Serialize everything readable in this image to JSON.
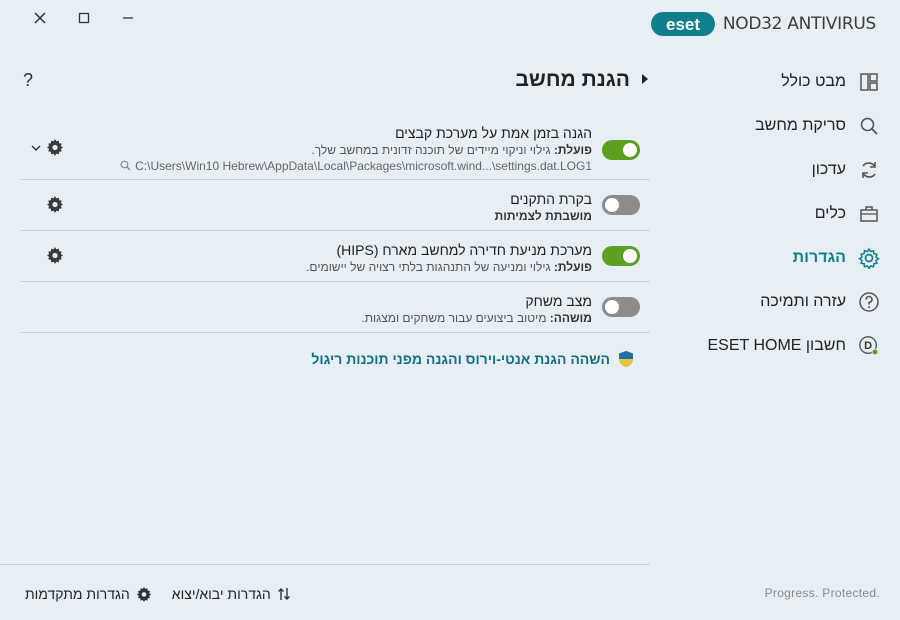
{
  "window": {
    "close": "close",
    "maximize": "maximize",
    "minimize": "minimize"
  },
  "brand": {
    "logo_text": "eset",
    "product": "NOD32 ANTIVIRUS"
  },
  "sidebar": {
    "items": [
      {
        "label": "מבט כולל",
        "icon": "overview-icon"
      },
      {
        "label": "סריקת מחשב",
        "icon": "search-icon"
      },
      {
        "label": "עדכון",
        "icon": "refresh-icon"
      },
      {
        "label": "כלים",
        "icon": "briefcase-icon"
      },
      {
        "label": "הגדרות",
        "icon": "gear-icon",
        "active": true
      },
      {
        "label": "עזרה ותמיכה",
        "icon": "help-icon"
      },
      {
        "label": "חשבון ESET HOME",
        "icon": "account-icon",
        "avatar_letter": "D"
      }
    ]
  },
  "main": {
    "help": "?",
    "title": "הגנת מחשב",
    "rows": [
      {
        "title": "הגנה בזמן אמת על מערכת קבצים",
        "status_label": "פועלת:",
        "status_text": " גילוי וניקוי מיידים של תוכנה זדונית במחשב שלך.",
        "path": "C:\\Users\\Win10 Hebrew\\AppData\\Local\\Packages\\microsoft.wind...\\settings.dat.LOG1",
        "enabled": true
      },
      {
        "title": "בקרת התקנים",
        "status_label": "מושבתת לצמיתות",
        "status_text": "",
        "enabled": false
      },
      {
        "title": "מערכת מניעת חדירה למחשב מארח (HIPS)",
        "status_label": "פועלת:",
        "status_text": " גילוי ומניעה של התנהגות בלתי רצויה של יישומים.",
        "enabled": true
      },
      {
        "title": "מצב משחק",
        "status_label": "מושהה:",
        "status_text": " מיטוב ביצועים עבור משחקים ומצגות.",
        "enabled": false
      }
    ],
    "pause_link": "השהה הגנת אנטי-וירוס והגנה מפני תוכנות ריגול"
  },
  "footer": {
    "advanced_settings": "הגדרות מתקדמות",
    "import_export": "הגדרות יבוא/יצוא",
    "tagline": "Progress. Protected."
  },
  "colors": {
    "accent": "#0f7f8c",
    "toggle_on": "#5da01f",
    "toggle_off": "#8c8c8c",
    "background": "#e7eef4"
  }
}
